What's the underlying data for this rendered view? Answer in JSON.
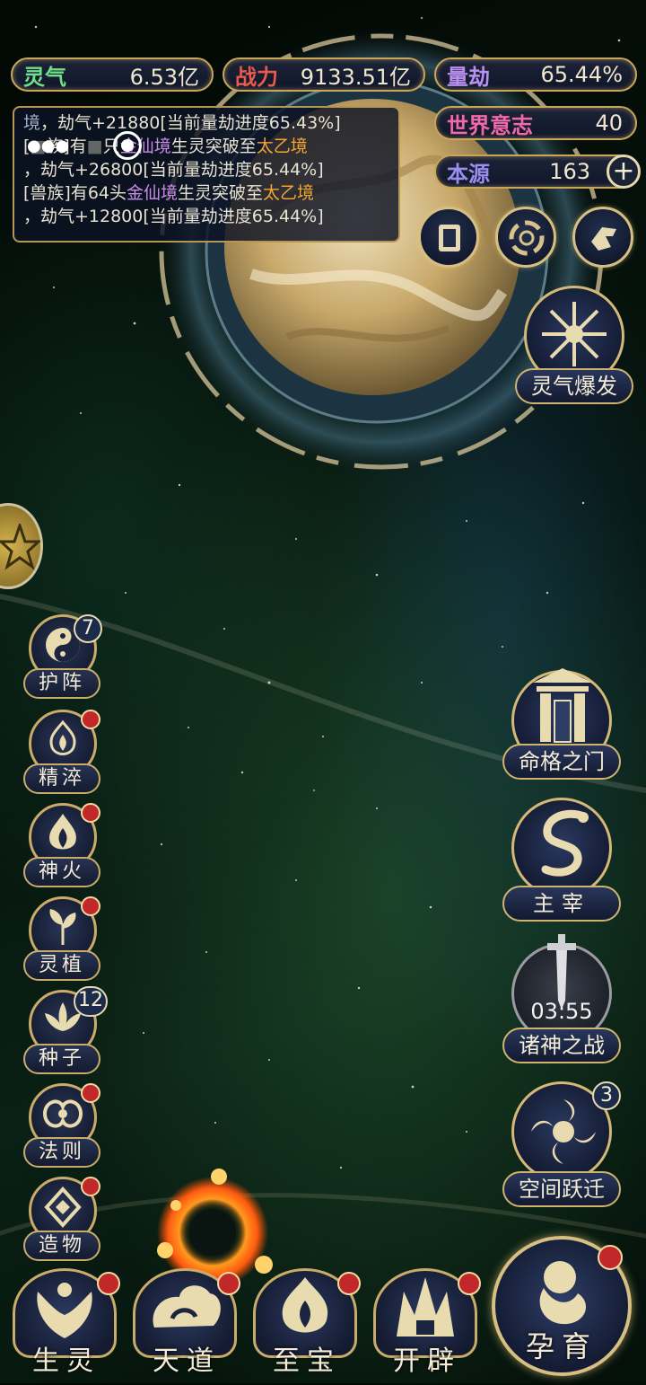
{
  "top_stats": {
    "lingqi": {
      "label": "灵气",
      "value": "6.53亿",
      "label_color": "#6fe08a"
    },
    "zhanli": {
      "label": "战力",
      "value": "9133.51亿",
      "label_color": "#e85a4a"
    },
    "liangjie": {
      "label": "量劫",
      "value": "65.44%",
      "label_color": "#b890f0"
    },
    "world_will": {
      "label": "世界意志",
      "value": "40",
      "label_color": "#f06aa8"
    },
    "benyuan": {
      "label": "本源",
      "value": "163",
      "label_color": "#9a8df0"
    }
  },
  "event_log": {
    "line1": {
      "prefix": "境",
      "rest": "，劫气+21880[当前量劫进度65.43%]"
    },
    "line2": {
      "a": "[",
      "b": "族]有",
      "c": "只",
      "realm1": "金仙境",
      "mid": "生灵突破至",
      "realm2": "太乙境"
    },
    "line3": {
      "text": "，劫气+26800[当前量劫进度65.44%]"
    },
    "line4": {
      "a": "[兽族]有64头",
      "realm1": "金仙境",
      "mid": "生灵突破至",
      "realm2": "太乙境"
    },
    "line5": {
      "text": "，劫气+12800[当前量劫进度65.44%]"
    }
  },
  "quick_icons": [
    "card-icon",
    "swirl-portal-icon",
    "hand-icon"
  ],
  "burst": {
    "label": "灵气爆发"
  },
  "left_menu": [
    {
      "label": "护阵",
      "badge": "7",
      "icon": "taiji-icon"
    },
    {
      "label": "精淬",
      "dot": true,
      "icon": "flame-orb-icon"
    },
    {
      "label": "神火",
      "dot": true,
      "icon": "fire-icon"
    },
    {
      "label": "灵植",
      "dot": true,
      "icon": "plant-icon"
    },
    {
      "label": "种子",
      "badge": "12",
      "icon": "lotus-icon"
    },
    {
      "label": "法则",
      "dot": true,
      "icon": "rune-icon"
    },
    {
      "label": "造物",
      "dot": true,
      "icon": "diamond-icon"
    }
  ],
  "right_menu": {
    "fate_gate": {
      "label": "命格之门"
    },
    "master": {
      "label": "主宰"
    },
    "gods_war": {
      "label": "诸神之战",
      "timer": "03:55"
    },
    "space_jump": {
      "label": "空间跃迁",
      "badge": "3"
    }
  },
  "bottom_menu": [
    {
      "label": "生灵",
      "dot": true
    },
    {
      "label": "天道",
      "dot": true
    },
    {
      "label": "至宝",
      "dot": true
    },
    {
      "label": "开辟",
      "dot": true
    }
  ],
  "incubate": {
    "label": "孕育",
    "dot": true
  },
  "colors": {
    "gold": "#c9ab6a",
    "panel": "#141b30",
    "alert": "#c0282a"
  }
}
